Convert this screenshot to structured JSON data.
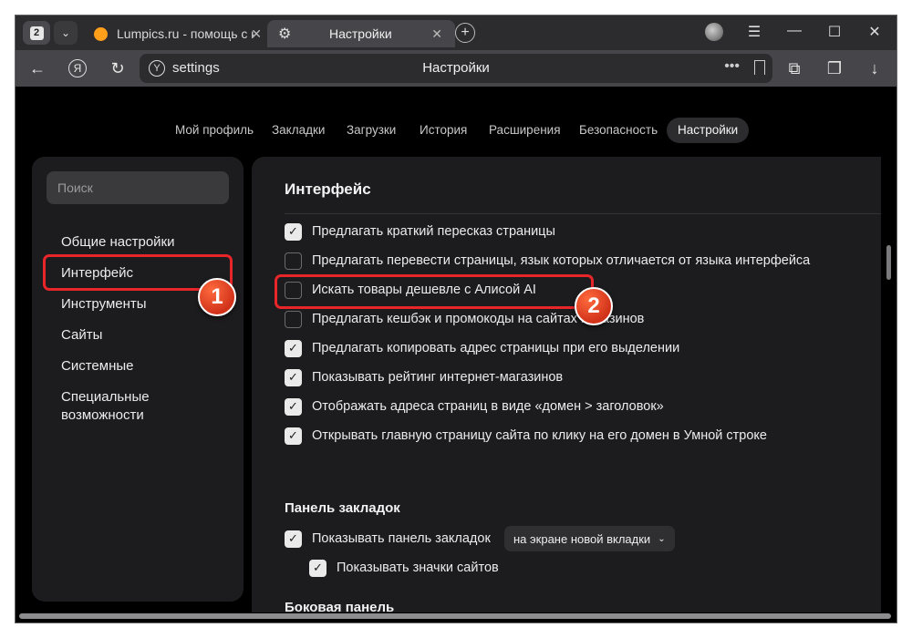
{
  "tabbar": {
    "tab_count": "2",
    "tabs": [
      {
        "title": "Lumpics.ru - помощь с компьютером"
      },
      {
        "title": "Настройки"
      }
    ]
  },
  "toolbar": {
    "url": "settings",
    "page_title": "Настройки"
  },
  "nav": {
    "tabs": [
      "Мой профиль",
      "Закладки",
      "Загрузки",
      "История",
      "Расширения",
      "Безопасность",
      "Настройки"
    ],
    "active": "Настройки"
  },
  "sidebar": {
    "search_placeholder": "Поиск",
    "items": [
      {
        "label": "Общие настройки"
      },
      {
        "label": "Интерфейс"
      },
      {
        "label": "Инструменты"
      },
      {
        "label": "Сайты"
      },
      {
        "label": "Системные"
      },
      {
        "label": "Специальные возможности"
      }
    ]
  },
  "main": {
    "section_title": "Интерфейс",
    "options": [
      {
        "label": "Предлагать краткий пересказ страницы",
        "checked": true
      },
      {
        "label": "Предлагать перевести страницы, язык которых отличается от языка интерфейса",
        "checked": false
      },
      {
        "label": "Искать товары дешевле с Алисой AI",
        "checked": false
      },
      {
        "label": "Предлагать кешбэк и промокоды на сайтах магазинов",
        "checked": false
      },
      {
        "label": "Предлагать копировать адрес страницы при его выделении",
        "checked": true
      },
      {
        "label": "Показывать рейтинг интернет-магазинов",
        "checked": true
      },
      {
        "label": "Отображать адреса страниц в виде «домен > заголовок»",
        "checked": true
      },
      {
        "label": "Открывать главную страницу сайта по клику на его домен в Умной строке",
        "checked": true
      }
    ],
    "bookmarks_title": "Панель закладок",
    "bookmarks_option": {
      "label": "Показывать панель закладок",
      "checked": true
    },
    "bookmarks_dropdown": "на экране новой вкладки",
    "site_icons_option": {
      "label": "Показывать значки сайтов",
      "checked": true
    },
    "next_section_title": "Боковая панель"
  },
  "annotations": {
    "badge_1": "1",
    "badge_2": "2",
    "color": "#e8262a"
  }
}
